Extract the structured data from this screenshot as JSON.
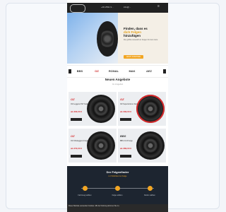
{
  "topbar": {
    "phone": "+49 2591 9...",
    "email": "info@..."
  },
  "hero": {
    "title_line1": "Finden, dass es",
    "title_highlight": "dich Felgen",
    "title_line2": "hinzufügen",
    "subtitle": "Die größte Auswahl an Felgen für dein Auto",
    "button": "JETZT SHOPPEN"
  },
  "brands": [
    "BBS",
    "OZ",
    "RONAL",
    "MAK",
    "AEZ"
  ],
  "section": {
    "title": "Neuen Angebote",
    "subtitle": "Im Angebot"
  },
  "products": [
    {
      "brand": "OZ",
      "name": "OZ Leggera HLT Felge",
      "price": "ab 329,00 €",
      "button": "Details"
    },
    {
      "brand": "OZ",
      "name": "OZ Superturismo Felge",
      "price": "ab 299,00 €",
      "button": "Details"
    },
    {
      "brand": "OZ",
      "name": "OZ Ultraleggera Felge",
      "price": "ab 279,00 €",
      "button": "Details"
    },
    {
      "brand": "BBS",
      "name": "BBS CI-R Felge",
      "price": "ab 389,00 €",
      "button": "Details"
    }
  ],
  "footer": {
    "title": "Der Felgenfinder",
    "subtitle": "in 3 Schritten zur Felge",
    "steps": [
      "Fahrzeug wählen",
      "Felge wählen",
      "Reifen wählen"
    ]
  },
  "cookie": {
    "text": "Diese Website verwendet Cookies. Mit der Nutzung stimmen Sie zu."
  },
  "colors": {
    "accent": "#f2a623",
    "sale_red": "#d8282a",
    "footer_bg": "#1d2530"
  }
}
